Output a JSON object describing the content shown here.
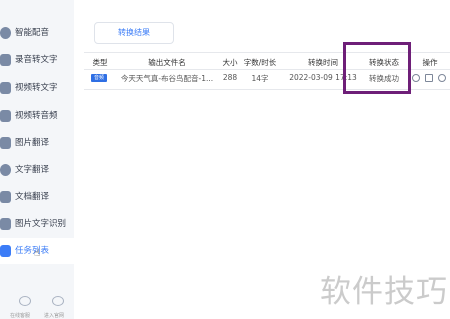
{
  "sidebar": {
    "items": [
      {
        "label": "智能配音",
        "icon": "voice-icon"
      },
      {
        "label": "录音转文字",
        "icon": "record-icon"
      },
      {
        "label": "视频转文字",
        "icon": "video-icon"
      },
      {
        "label": "视频转音频",
        "icon": "audio-icon"
      },
      {
        "label": "图片翻译",
        "icon": "image-icon"
      },
      {
        "label": "文字翻译",
        "icon": "translate-icon"
      },
      {
        "label": "文档翻译",
        "icon": "document-icon"
      },
      {
        "label": "图片文字识别",
        "icon": "ocr-icon"
      },
      {
        "label": "任务列表",
        "icon": "task-list-icon"
      }
    ],
    "footer": [
      "在线客服",
      "进入官网"
    ]
  },
  "main": {
    "tab_label": "转换结果",
    "table": {
      "columns": [
        "类型",
        "输出文件名",
        "大小",
        "字数/时长",
        "转换时间",
        "转换状态",
        "操作"
      ],
      "rows": [
        {
          "type_badge": "音频",
          "file_name": "今天天气真-布谷鸟配音-1...",
          "size": "288",
          "length": "14字",
          "time": "2022-03-09 17:13",
          "status": "转换成功"
        }
      ]
    }
  },
  "watermark": "软件技巧",
  "colors": {
    "accent": "#3b7cf7",
    "highlight": "#6e1f78",
    "badge": "#2f6fe4"
  }
}
